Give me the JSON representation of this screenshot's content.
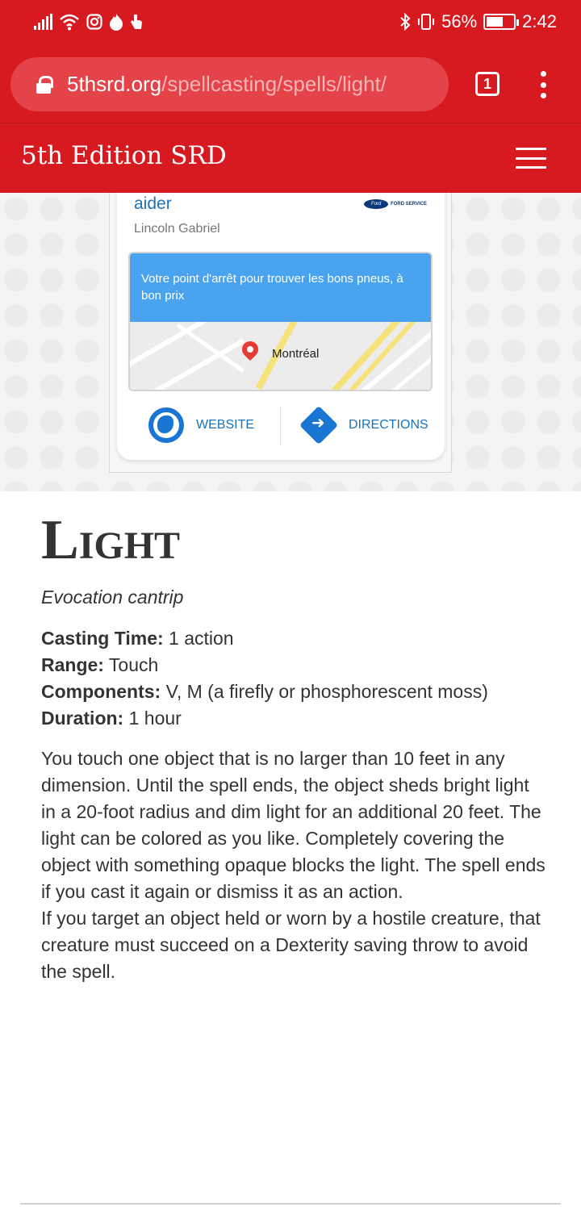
{
  "status_bar": {
    "battery_percent": "56%",
    "time": "2:42"
  },
  "url_bar": {
    "domain": "5thsrd.org",
    "path": "/spellcasting/spells/light/",
    "tab_count": "1"
  },
  "site": {
    "title": "5th Edition SRD"
  },
  "ad": {
    "name": "aider",
    "brand": "FORD SERVICE",
    "person": "Lincoln Gabriel",
    "tagline": "Votre point d'arrêt pour trouver les bons pneus, à bon prix",
    "map_label": "Montréal",
    "website_label": "WEBSITE",
    "directions_label": "DIRECTIONS"
  },
  "spell": {
    "title_first": "L",
    "title_rest": "ight",
    "school": "Evocation cantrip",
    "properties": [
      {
        "label": "Casting Time:",
        "value": " 1 action"
      },
      {
        "label": "Range:",
        "value": " Touch"
      },
      {
        "label": "Components:",
        "value": " V, M (a firefly or phosphorescent moss)"
      },
      {
        "label": "Duration:",
        "value": " 1 hour"
      }
    ],
    "body": [
      "You touch one object that is no larger than 10 feet in any dimension. Until the spell ends, the object sheds bright light in a 20-foot radius and dim light for an additional 20 feet. The light can be colored as you like. Completely covering the object with something opaque blocks the light. The spell ends if you cast it again or dismiss it as an action.",
      "If you target an object held or worn by a hostile creature, that creature must succeed on a Dexterity saving throw to avoid the spell."
    ]
  }
}
